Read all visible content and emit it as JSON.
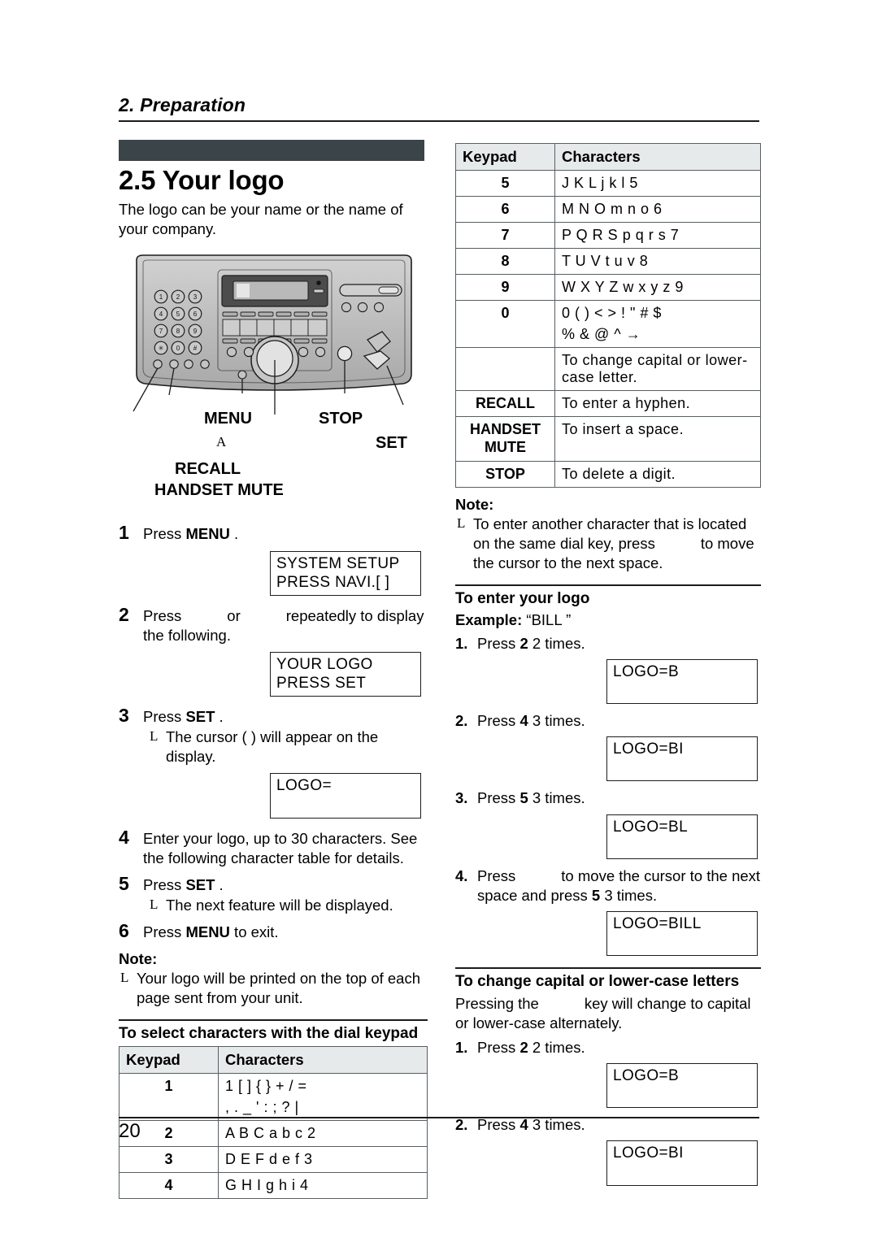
{
  "running_head": "2. Preparation",
  "page_number": "20",
  "section": {
    "title": "2.5 Your logo",
    "intro": "The logo can be your name or the name of your company."
  },
  "diagram": {
    "name": "fax-machine-control-panel",
    "keypad_keys": [
      "1",
      "2",
      "3",
      "4",
      "5",
      "6",
      "7",
      "8",
      "9",
      "*",
      "0",
      "#"
    ],
    "callouts": [
      {
        "label": "MENU"
      },
      {
        "label": "STOP"
      },
      {
        "label": "SET"
      },
      {
        "label": "RECALL"
      },
      {
        "label": "HANDSET MUTE"
      },
      {
        "label": "A"
      }
    ]
  },
  "steps": [
    {
      "num": "1",
      "parts": [
        "Press ",
        "MENU",
        " ."
      ]
    },
    {
      "num": "2",
      "text_a": "Press",
      "text_or": "or",
      "text_b": "repeatedly to display the following."
    },
    {
      "num": "3",
      "parts": [
        "Press ",
        "SET",
        " ."
      ],
      "sub": "The cursor ( ) will appear on the display."
    },
    {
      "num": "4",
      "text": "Enter your logo, up to 30 characters. See the following character table for details."
    },
    {
      "num": "5",
      "parts": [
        "Press ",
        "SET",
        " ."
      ],
      "sub": "The next feature will be displayed."
    },
    {
      "num": "6",
      "parts": [
        "Press ",
        "MENU",
        " to exit."
      ]
    }
  ],
  "lcds_left": [
    {
      "line1": "SYSTEM  SETUP",
      "line2": "PRESS  NAVI.[      ]"
    },
    {
      "line1": "YOUR  LOGO",
      "line2": "PRESS  SET"
    },
    {
      "line1": "LOGO=",
      "line2": ""
    }
  ],
  "note_left": {
    "heading": "Note:",
    "body": "Your logo will be printed on the top of each page sent from your unit."
  },
  "subhead_keypad": "To select characters with the dial keypad",
  "table_left": {
    "headers": [
      "Keypad",
      "Characters"
    ],
    "rows": [
      {
        "key": "1",
        "chars": "1  [   ]   {   }   +       /   =",
        "chars2": ",   .   _   '   :   ;   ?   |"
      },
      {
        "key": "2",
        "chars": "A  B  C  a  b  c  2"
      },
      {
        "key": "3",
        "chars": "D  E  F  d  e  f  3"
      },
      {
        "key": "4",
        "chars": "G  H  I   g  h  i   4"
      }
    ]
  },
  "table_right": {
    "headers": [
      "Keypad",
      "Characters"
    ],
    "rows": [
      {
        "key": "5",
        "chars": "J  K  L  j   k   l   5"
      },
      {
        "key": "6",
        "chars": "M  N  O  m  n  o  6"
      },
      {
        "key": "7",
        "chars": "P  Q  R  S  p  q  r   s  7"
      },
      {
        "key": "8",
        "chars": "T  U  V  t   u  v  8"
      },
      {
        "key": "9",
        "chars": "W  X  Y  Z  w  x  y  z  9"
      },
      {
        "key": "0",
        "chars": "0  (   )   <   >   !   \"   #   $",
        "chars2": "%  &          @  ^         →"
      },
      {
        "key": "",
        "chars": "To change capital or lower-case letter."
      },
      {
        "key": "RECALL",
        "chars": "To enter a hyphen."
      },
      {
        "key": "HANDSET MUTE",
        "chars": "To insert a space."
      },
      {
        "key": "STOP",
        "chars": "To delete a digit."
      }
    ]
  },
  "note_right": {
    "heading": "Note:",
    "body_a": "To enter another character that is located on the same dial key, press",
    "body_b": "to move the cursor to the next space."
  },
  "enter_logo": {
    "heading": "To enter your logo",
    "example_label": "Example:",
    "example_value": "“BILL ”",
    "steps": [
      {
        "n": "1.",
        "a": "Press",
        "k": "2",
        "b": "2 times.",
        "lcd": "LOGO=B"
      },
      {
        "n": "2.",
        "a": "Press",
        "k": "4",
        "b": "3 times.",
        "lcd": "LOGO=BI"
      },
      {
        "n": "3.",
        "a": "Press",
        "k": "5",
        "b": "3 times.",
        "lcd": "LOGO=BL"
      },
      {
        "n": "4.",
        "a": "Press",
        "mid": "to move the cursor to the next space and press",
        "k": "5",
        "b": "3 times.",
        "lcd": "LOGO=BILL"
      }
    ]
  },
  "change_case": {
    "heading": "To change capital or lower-case letters",
    "body_a": "Pressing the",
    "body_b": "key will change to capital or lower-case alternately.",
    "steps": [
      {
        "n": "1.",
        "a": "Press",
        "k": "2",
        "b": "2 times.",
        "lcd": "LOGO=B"
      },
      {
        "n": "2.",
        "a": "Press",
        "k": "4",
        "b": "3 times.",
        "lcd": "LOGO=BI"
      }
    ]
  },
  "colors": {
    "banner": "#3b4449",
    "table_header": "#e7eaeb",
    "rule": "#1b1b1b"
  }
}
